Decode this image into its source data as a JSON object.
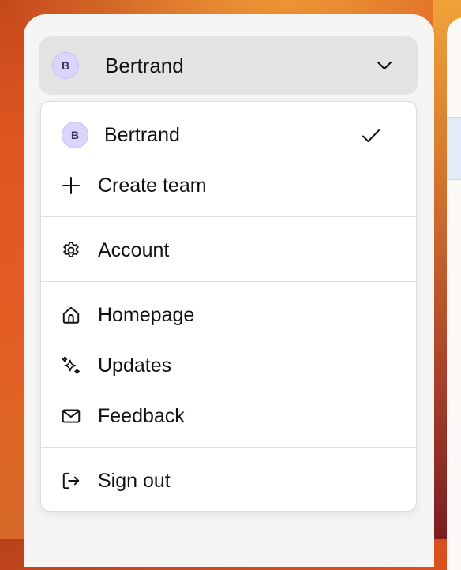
{
  "selector": {
    "avatar_initial": "B",
    "name": "Bertrand"
  },
  "menu": {
    "user": {
      "avatar_initial": "B",
      "name": "Bertrand"
    },
    "create_team": "Create team",
    "account": "Account",
    "homepage": "Homepage",
    "updates": "Updates",
    "feedback": "Feedback",
    "sign_out": "Sign out"
  },
  "colors": {
    "avatar_bg": "#dcd5fb",
    "panel_bg": "#f6f5f4",
    "selector_bg": "#e4e3e2",
    "menu_bg": "#ffffff"
  },
  "icons": {
    "selector_toggle": "chevron-down-icon",
    "user_selected": "checkmark-icon",
    "create_team": "plus-icon",
    "account": "gear-icon",
    "homepage": "home-icon",
    "updates": "sparkles-icon",
    "feedback": "mail-icon",
    "sign_out": "sign-out-icon"
  }
}
